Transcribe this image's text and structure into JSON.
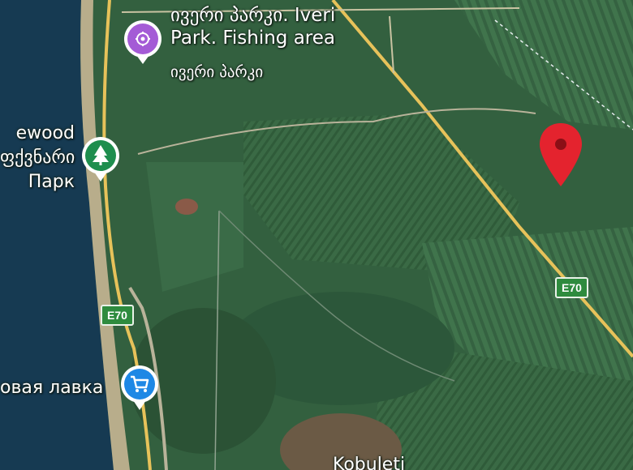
{
  "map": {
    "colors": {
      "sea": "#163a52",
      "land": "#35603f",
      "field": "#3f7049",
      "highway": "#e7c25a",
      "road": "#c9c3a2",
      "pin": "#e4232e"
    }
  },
  "pois": [
    {
      "id": "iveri",
      "name_line1": "ივერი პარკი. Iveri",
      "name_line2": "Park. Fishing area",
      "sub": "ივერი პარკი",
      "icon": "camera-icon",
      "color": "#a45bd6"
    },
    {
      "id": "pinewood",
      "name_line1": "ewood",
      "name_line2": "ფქვნარი",
      "sub": "Парк",
      "icon": "tree-icon",
      "color": "#1e8e4e"
    },
    {
      "id": "shop",
      "name_line1": "овая лавка",
      "icon": "cart-icon",
      "color": "#1e88e5"
    }
  ],
  "roads": [
    {
      "label": "E70"
    },
    {
      "label": "E70"
    }
  ],
  "places": {
    "town": "Kobuleti"
  },
  "marker": {
    "icon": "location-pin-icon"
  }
}
